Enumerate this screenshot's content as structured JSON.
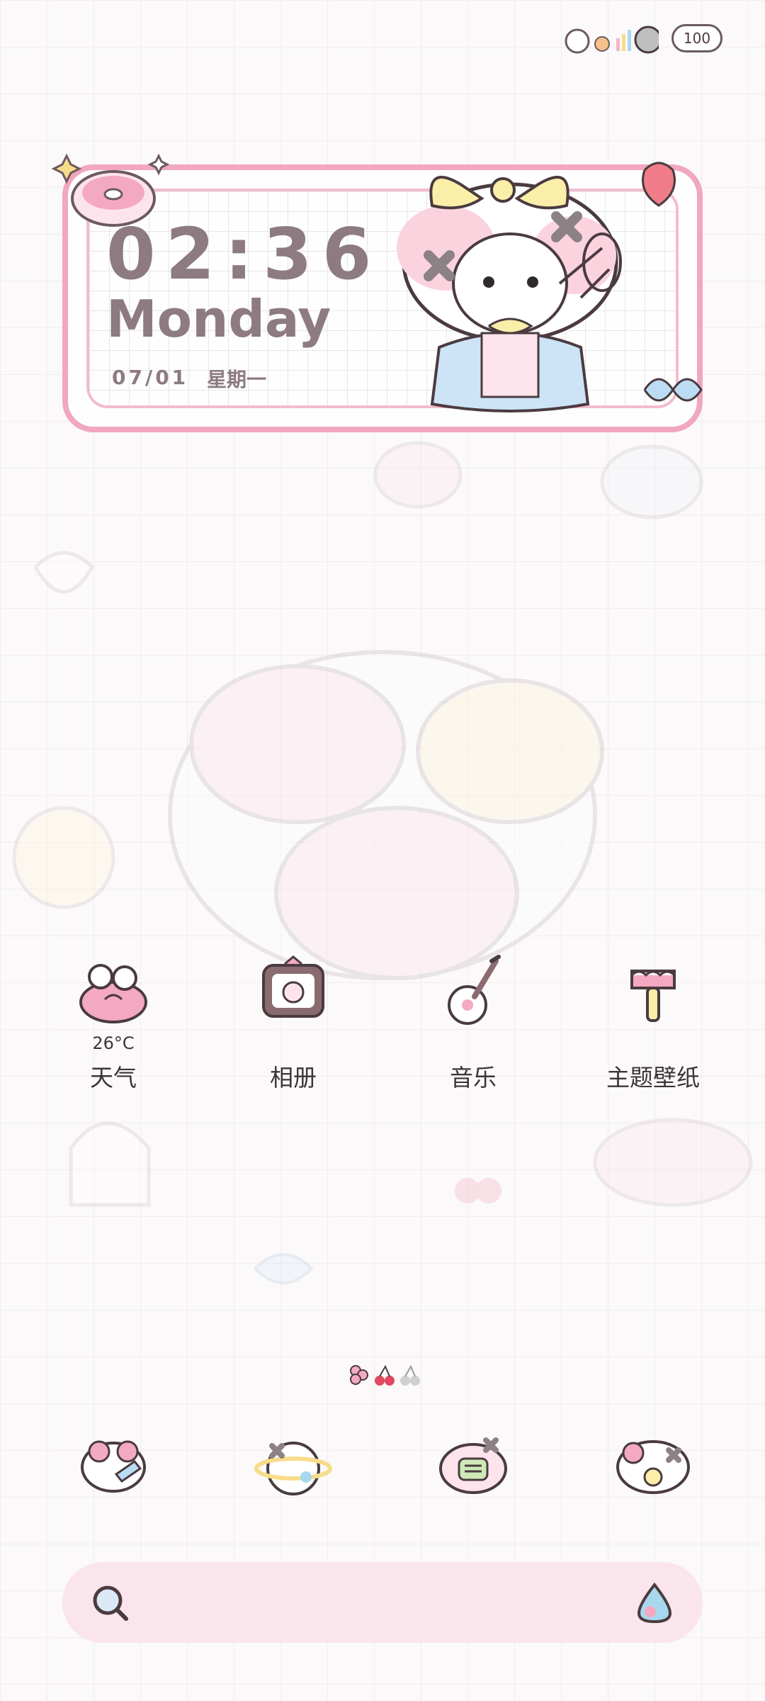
{
  "status_bar": {
    "battery": "100"
  },
  "clock_widget": {
    "time": "02:36",
    "day": "Monday",
    "date": "07/01",
    "weekday": "星期一"
  },
  "apps": [
    {
      "label": "天气",
      "extra": "26°C",
      "icon": "weather-icon"
    },
    {
      "label": "相册",
      "icon": "gallery-icon"
    },
    {
      "label": "音乐",
      "icon": "music-icon"
    },
    {
      "label": "主题壁纸",
      "icon": "theme-wallpaper-icon"
    }
  ],
  "dock": [
    {
      "icon": "phone-icon"
    },
    {
      "icon": "browser-icon"
    },
    {
      "icon": "messages-icon"
    },
    {
      "icon": "camera-icon"
    }
  ],
  "page_indicator": {
    "pages": 3,
    "current": 1
  },
  "search_bar": {
    "left_icon": "search-icon",
    "right_icon": "voice-assistant-icon"
  },
  "colors": {
    "accent_pink": "#f0a7bf",
    "text": "#8d7b7f",
    "search_bg": "#fbe5ec"
  }
}
